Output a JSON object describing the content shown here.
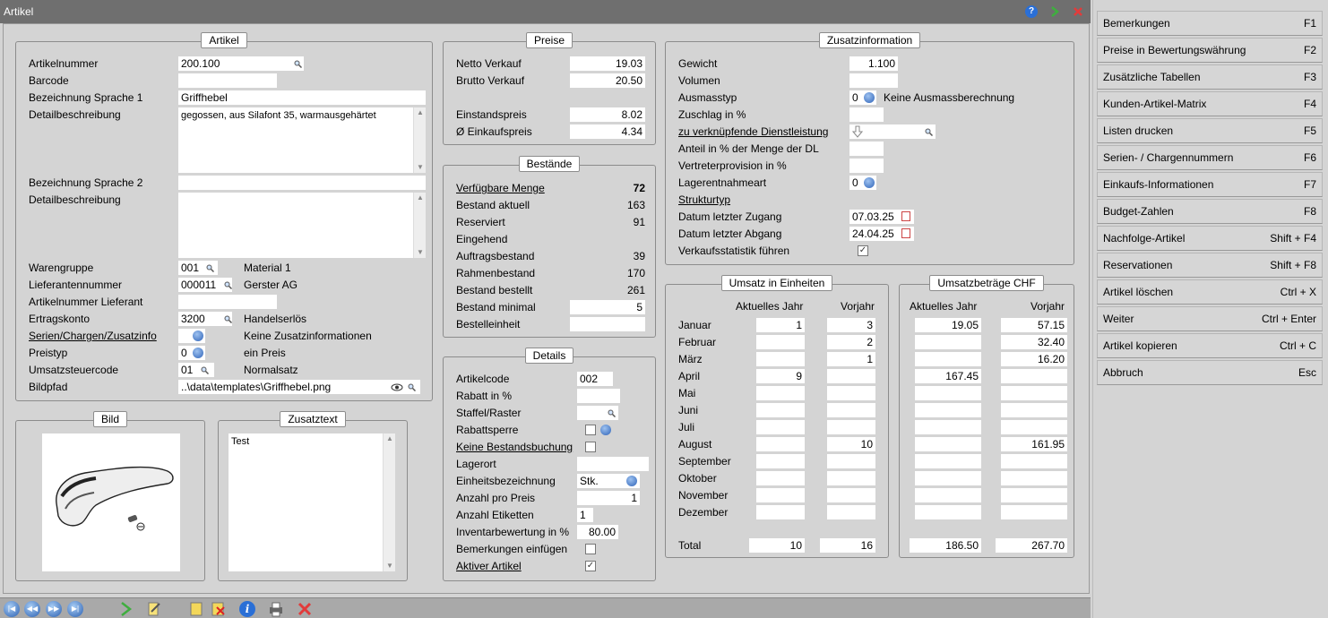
{
  "window": {
    "title": "Artikel"
  },
  "artikel": {
    "title": "Artikel",
    "rows": [
      {
        "label": "Artikelnummer",
        "value": "200.100"
      },
      {
        "label": "Barcode",
        "value": ""
      },
      {
        "label": "Bezeichnung Sprache 1",
        "value": "Griffhebel"
      },
      {
        "label": "Detailbeschreibung",
        "value": "gegossen, aus Silafont 35, warmausgehärtet"
      },
      {
        "label": "Bezeichnung Sprache 2",
        "value": ""
      },
      {
        "label": "Detailbeschreibung",
        "value": ""
      },
      {
        "label": "Warengruppe",
        "value": "001",
        "info": "Material 1"
      },
      {
        "label": "Lieferantennummer",
        "value": "000011",
        "info": "Gerster AG"
      },
      {
        "label": "Artikelnummer Lieferant",
        "value": ""
      },
      {
        "label": "Ertragskonto",
        "value": "3200",
        "info": "Handelserlös"
      },
      {
        "label": "Serien/Chargen/Zusatzinfo",
        "value": "",
        "info": "Keine Zusatzinformationen"
      },
      {
        "label": "Preistyp",
        "value": "0",
        "info": "ein Preis"
      },
      {
        "label": "Umsatzsteuercode",
        "value": "01",
        "info": "Normalsatz"
      },
      {
        "label": "Bildpfad",
        "value": "..\\data\\templates\\Griffhebel.png"
      }
    ]
  },
  "preise": {
    "title": "Preise",
    "rows": [
      {
        "label": "Netto Verkauf",
        "value": "19.03"
      },
      {
        "label": "Brutto Verkauf",
        "value": "20.50"
      },
      {
        "label": "Einstandspreis",
        "value": "8.02"
      },
      {
        "label": "Ø Einkaufspreis",
        "value": "4.34"
      }
    ]
  },
  "bestaende": {
    "title": "Bestände",
    "rows": [
      {
        "label": "Verfügbare Menge",
        "value": "72"
      },
      {
        "label": "Bestand aktuell",
        "value": "163"
      },
      {
        "label": "Reserviert",
        "value": "91"
      },
      {
        "label": "Eingehend",
        "value": ""
      },
      {
        "label": "Auftragsbestand",
        "value": "39"
      },
      {
        "label": "Rahmenbestand",
        "value": "170"
      },
      {
        "label": "Bestand bestellt",
        "value": "261"
      },
      {
        "label": "Bestand minimal",
        "value": "5"
      },
      {
        "label": "Bestelleinheit",
        "value": ""
      }
    ]
  },
  "details": {
    "title": "Details",
    "rows": [
      {
        "label": "Artikelcode",
        "value": "002"
      },
      {
        "label": "Rabatt in %",
        "value": ""
      },
      {
        "label": "Staffel/Raster",
        "value": ""
      },
      {
        "label": "Rabattsperre",
        "value": ""
      },
      {
        "label": "Keine Bestandsbuchung",
        "value": ""
      },
      {
        "label": "Lagerort",
        "value": ""
      },
      {
        "label": "Einheitsbezeichnung",
        "value": "Stk."
      },
      {
        "label": "Anzahl pro Preis",
        "value": "1"
      },
      {
        "label": "Anzahl Etiketten",
        "value": "1"
      },
      {
        "label": "Inventarbewertung in %",
        "value": "80.00"
      },
      {
        "label": "Bemerkungen einfügen",
        "value": ""
      },
      {
        "label": "Aktiver Artikel",
        "value": "✓"
      }
    ]
  },
  "zusatz": {
    "title": "Zusatzinformation",
    "rows": [
      {
        "label": "Gewicht",
        "value": "1.100"
      },
      {
        "label": "Volumen",
        "value": ""
      },
      {
        "label": "Ausmasstyp",
        "value": "0",
        "info": "Keine Ausmassberechnung"
      },
      {
        "label": "Zuschlag in %",
        "value": ""
      },
      {
        "label": "zu verknüpfende Dienstleistung",
        "value": ""
      },
      {
        "label": "Anteil in % der Menge der DL",
        "value": ""
      },
      {
        "label": "Vertreterprovision in %",
        "value": ""
      },
      {
        "label": "Lagerentnahmeart",
        "value": "0"
      },
      {
        "label": "Strukturtyp",
        "value": ""
      },
      {
        "label": "Datum letzter Zugang",
        "value": "07.03.25"
      },
      {
        "label": "Datum letzter Abgang",
        "value": "24.04.25"
      },
      {
        "label": "Verkaufsstatistik führen",
        "value": "✓"
      }
    ]
  },
  "bild": {
    "title": "Bild"
  },
  "zusatztext": {
    "title": "Zusatztext",
    "text": "Test"
  },
  "umsatz": {
    "title": "Umsatz in Einheiten",
    "col1": "Aktuelles Jahr",
    "col2": "Vorjahr",
    "total_label": "Total",
    "months": [
      {
        "name": "Januar",
        "a": "1",
        "v": "3"
      },
      {
        "name": "Februar",
        "a": "",
        "v": "2"
      },
      {
        "name": "März",
        "a": "",
        "v": "1"
      },
      {
        "name": "April",
        "a": "9",
        "v": ""
      },
      {
        "name": "Mai",
        "a": "",
        "v": ""
      },
      {
        "name": "Juni",
        "a": "",
        "v": ""
      },
      {
        "name": "Juli",
        "a": "",
        "v": ""
      },
      {
        "name": "August",
        "a": "",
        "v": "10"
      },
      {
        "name": "September",
        "a": "",
        "v": ""
      },
      {
        "name": "Oktober",
        "a": "",
        "v": ""
      },
      {
        "name": "November",
        "a": "",
        "v": ""
      },
      {
        "name": "Dezember",
        "a": "",
        "v": ""
      }
    ],
    "total_a": "10",
    "total_v": "16"
  },
  "betraege": {
    "title": "Umsatzbeträge CHF",
    "col1": "Aktuelles Jahr",
    "col2": "Vorjahr",
    "months": [
      {
        "a": "19.05",
        "v": "57.15"
      },
      {
        "a": "",
        "v": "32.40"
      },
      {
        "a": "",
        "v": "16.20"
      },
      {
        "a": "167.45",
        "v": ""
      },
      {
        "a": "",
        "v": ""
      },
      {
        "a": "",
        "v": ""
      },
      {
        "a": "",
        "v": ""
      },
      {
        "a": "",
        "v": "161.95"
      },
      {
        "a": "",
        "v": ""
      },
      {
        "a": "",
        "v": ""
      },
      {
        "a": "",
        "v": ""
      },
      {
        "a": "",
        "v": ""
      }
    ],
    "total_a": "186.50",
    "total_v": "267.70"
  },
  "sidebar": {
    "items": [
      {
        "label": "Bemerkungen",
        "key": "F1"
      },
      {
        "label": "Preise in Bewertungswährung",
        "key": "F2"
      },
      {
        "label": "Zusätzliche Tabellen",
        "key": "F3"
      },
      {
        "label": "Kunden-Artikel-Matrix",
        "key": "F4"
      },
      {
        "label": "Listen drucken",
        "key": "F5"
      },
      {
        "label": "Serien- / Chargennummern",
        "key": "F6"
      },
      {
        "label": "Einkaufs-Informationen",
        "key": "F7"
      },
      {
        "label": "Budget-Zahlen",
        "key": "F8"
      },
      {
        "label": "Nachfolge-Artikel",
        "key": "Shift + F4"
      },
      {
        "label": "Reservationen",
        "key": "Shift + F8"
      },
      {
        "label": "Artikel löschen",
        "key": "Ctrl + X"
      },
      {
        "label": "Weiter",
        "key": "Ctrl + Enter"
      },
      {
        "label": "Artikel kopieren",
        "key": "Ctrl + C"
      },
      {
        "label": "Abbruch",
        "key": "Esc"
      }
    ]
  },
  "icons": [
    "help-icon",
    "go-icon",
    "close-icon",
    "magnifier-icon",
    "dropdown-icon",
    "calendar-icon",
    "eye-icon",
    "first-record-icon",
    "previous-record-icon",
    "next-record-icon",
    "last-record-icon",
    "run-icon",
    "edit-icon",
    "new-icon",
    "delete-icon",
    "info-icon",
    "print-icon",
    "cancel-icon"
  ],
  "colors": {
    "titlebar": "#6f6f6f",
    "panel": "#d4d4d4",
    "field": "#ffffff",
    "sidebar_button": "#d6d6d6"
  }
}
